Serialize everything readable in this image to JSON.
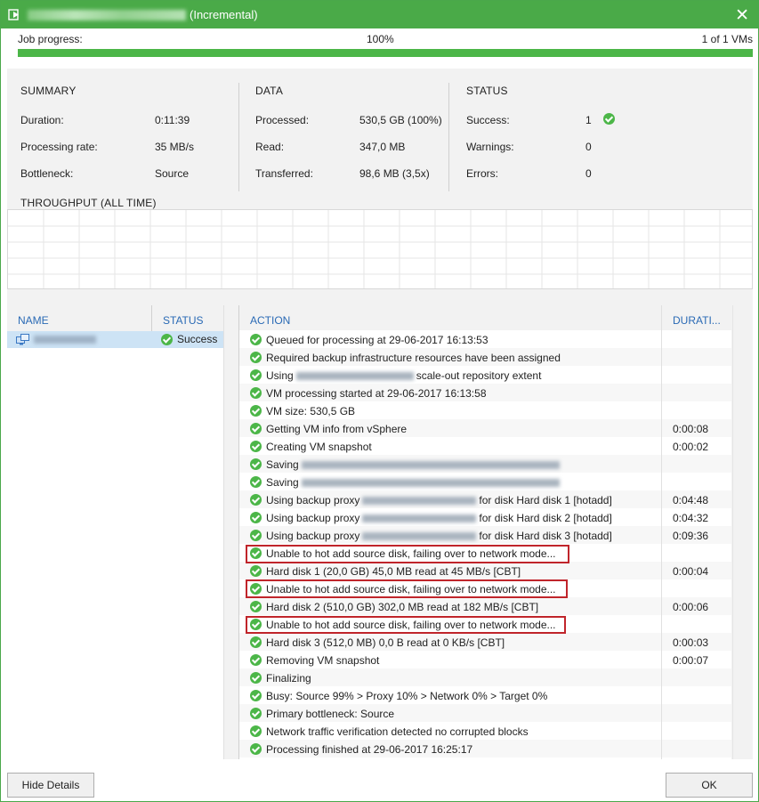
{
  "window": {
    "title_suffix": "(Incremental)",
    "close_glyph": "✕"
  },
  "progress": {
    "label": "Job progress:",
    "percent_text": "100%",
    "value": 1.0,
    "vm_count": "1 of 1 VMs"
  },
  "summary": {
    "heading": "SUMMARY",
    "duration_label": "Duration:",
    "duration": "0:11:39",
    "rate_label": "Processing rate:",
    "rate": "35 MB/s",
    "bottleneck_label": "Bottleneck:",
    "bottleneck": "Source"
  },
  "data": {
    "heading": "DATA",
    "processed_label": "Processed:",
    "processed": "530,5 GB (100%)",
    "read_label": "Read:",
    "read": "347,0 MB",
    "transferred_label": "Transferred:",
    "transferred": "98,6 MB (3,5x)"
  },
  "status": {
    "heading": "STATUS",
    "success_label": "Success:",
    "success": "1",
    "warnings_label": "Warnings:",
    "warnings": "0",
    "errors_label": "Errors:",
    "errors": "0"
  },
  "throughput": {
    "heading": "THROUGHPUT (ALL TIME)"
  },
  "vm_table": {
    "name_header": "NAME",
    "status_header": "STATUS",
    "rows": [
      {
        "status": "Success"
      }
    ]
  },
  "actions": {
    "action_header": "ACTION",
    "duration_header": "DURATI...",
    "rows": [
      {
        "pre": "Queued for processing at 29-06-2017 16:13:53",
        "post": "",
        "duration": ""
      },
      {
        "pre": "Required backup infrastructure resources have been assigned",
        "post": "",
        "duration": ""
      },
      {
        "pre": "Using",
        "post": "scale-out repository extent",
        "duration": ""
      },
      {
        "pre": "VM processing started at 29-06-2017 16:13:58",
        "post": "",
        "duration": ""
      },
      {
        "pre": "VM size: 530,5 GB",
        "post": "",
        "duration": ""
      },
      {
        "pre": "Getting VM info from vSphere",
        "post": "",
        "duration": "0:00:08"
      },
      {
        "pre": "Creating VM snapshot",
        "post": "",
        "duration": "0:00:02"
      },
      {
        "pre": "Saving",
        "post": "",
        "duration": ""
      },
      {
        "pre": "Saving",
        "post": "",
        "duration": ""
      },
      {
        "pre": "Using backup proxy",
        "post": "for disk Hard disk 1 [hotadd]",
        "duration": "0:04:48"
      },
      {
        "pre": "Using backup proxy",
        "post": "for disk Hard disk 2 [hotadd]",
        "duration": "0:04:32"
      },
      {
        "pre": "Using backup proxy",
        "post": "for disk Hard disk 3 [hotadd]",
        "duration": "0:09:36"
      },
      {
        "pre": "Unable to hot add source disk, failing over to network mode...",
        "post": "",
        "duration": ""
      },
      {
        "pre": "Hard disk 1 (20,0 GB) 45,0 MB read at 45 MB/s [CBT]",
        "post": "",
        "duration": "0:00:04"
      },
      {
        "pre": "Unable to hot add source disk, failing over to network mode...",
        "post": "",
        "duration": ""
      },
      {
        "pre": "Hard disk 2 (510,0 GB) 302,0 MB read at 182 MB/s [CBT]",
        "post": "",
        "duration": "0:00:06"
      },
      {
        "pre": "Unable to hot add source disk, failing over to network mode...",
        "post": "",
        "duration": ""
      },
      {
        "pre": "Hard disk 3 (512,0 MB) 0,0 B read at 0 KB/s [CBT]",
        "post": "",
        "duration": "0:00:03"
      },
      {
        "pre": "Removing VM snapshot",
        "post": "",
        "duration": "0:00:07"
      },
      {
        "pre": "Finalizing",
        "post": "",
        "duration": ""
      },
      {
        "pre": "Busy: Source 99% > Proxy 10% > Network 0% > Target 0%",
        "post": "",
        "duration": ""
      },
      {
        "pre": "Primary bottleneck: Source",
        "post": "",
        "duration": ""
      },
      {
        "pre": "Network traffic verification detected no corrupted blocks",
        "post": "",
        "duration": ""
      },
      {
        "pre": "Processing finished at 29-06-2017 16:25:17",
        "post": "",
        "duration": ""
      }
    ]
  },
  "buttons": {
    "hide_details": "Hide Details",
    "ok": "OK"
  },
  "colors": {
    "accent": "#4aaa48",
    "highlight": "#c0252b",
    "link_header": "#2a6ab5",
    "selection": "#cde3f5"
  },
  "icons": {
    "app": "veeam-job-icon",
    "close": "close-icon",
    "status": "success-check-icon",
    "vm": "vm-icon"
  }
}
